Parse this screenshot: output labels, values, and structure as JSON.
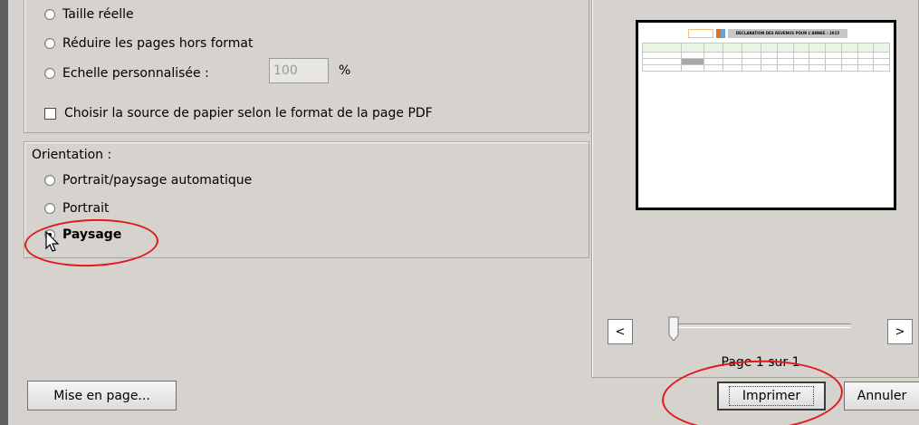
{
  "scaling": {
    "actual_size_label": "Taille réelle",
    "shrink_label": "Réduire les pages hors format",
    "custom_scale_label": "Echelle personnalisée :",
    "custom_scale_value": "100",
    "percent_sign": "%",
    "paper_source_label": "Choisir la source de papier selon le format de la page PDF"
  },
  "orientation": {
    "group_label": "Orientation :",
    "options": [
      {
        "label": "Portrait/paysage automatique",
        "selected": false
      },
      {
        "label": "Portrait",
        "selected": false
      },
      {
        "label": "Paysage",
        "selected": true
      }
    ]
  },
  "preview": {
    "doc_title": "DECLARATION DES REVENUS POUR L'ANNEE : 2015",
    "page_count": "Page 1 sur 1",
    "prev_label": "<",
    "next_label": ">"
  },
  "buttons": {
    "page_setup": "Mise en page...",
    "print": "Imprimer",
    "cancel": "Annuler"
  },
  "colors": {
    "annotation_red": "#e0191f",
    "dialog_bg": "#d6d3ce"
  }
}
